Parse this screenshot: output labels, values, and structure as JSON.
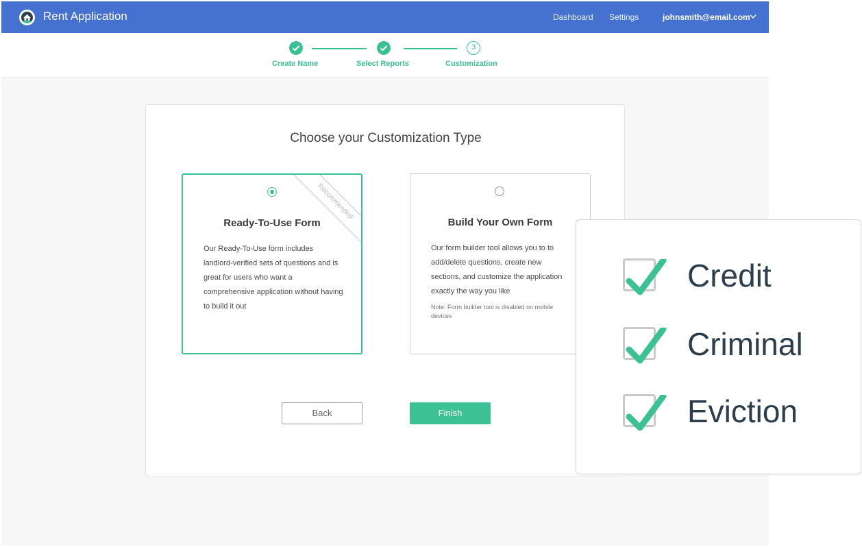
{
  "header": {
    "title": "Rent Application",
    "nav": [
      "Dashboard",
      "Settings"
    ],
    "user_email": "johnsmith@email.com",
    "logo_icon": "house-logo-icon",
    "dropdown_icon": "chevron-down-icon",
    "background_color": "#4572d1"
  },
  "stepper": {
    "accent_color": "#3cc195",
    "steps": [
      {
        "label": "Create Name",
        "state": "complete",
        "icon": "check-icon"
      },
      {
        "label": "Select Reports",
        "state": "complete",
        "icon": "check-icon"
      },
      {
        "label": "Customization",
        "state": "current",
        "number": "3"
      }
    ]
  },
  "main": {
    "title": "Choose your Customization Type",
    "options": [
      {
        "title": "Ready-To-Use Form",
        "selected": true,
        "ribbon": "Recommended",
        "description": "Our Ready-To-Use form includes landlord-verified sets of questions and is great for users who want a comprehensive application without having to build it out"
      },
      {
        "title": "Build Your Own Form",
        "selected": false,
        "description": "Our form builder tool allows you to to add/delete questions, create new sections, and customize the application exactly the way you like",
        "note": "Note: Form builder tool is disabled on mobile devices"
      }
    ],
    "back_label": "Back",
    "finish_label": "Finish"
  },
  "reports_overlay": {
    "items": [
      {
        "label": "Credit",
        "checked": true
      },
      {
        "label": "Criminal",
        "checked": true
      },
      {
        "label": "Eviction",
        "checked": true
      }
    ],
    "check_color": "#3cc195"
  }
}
